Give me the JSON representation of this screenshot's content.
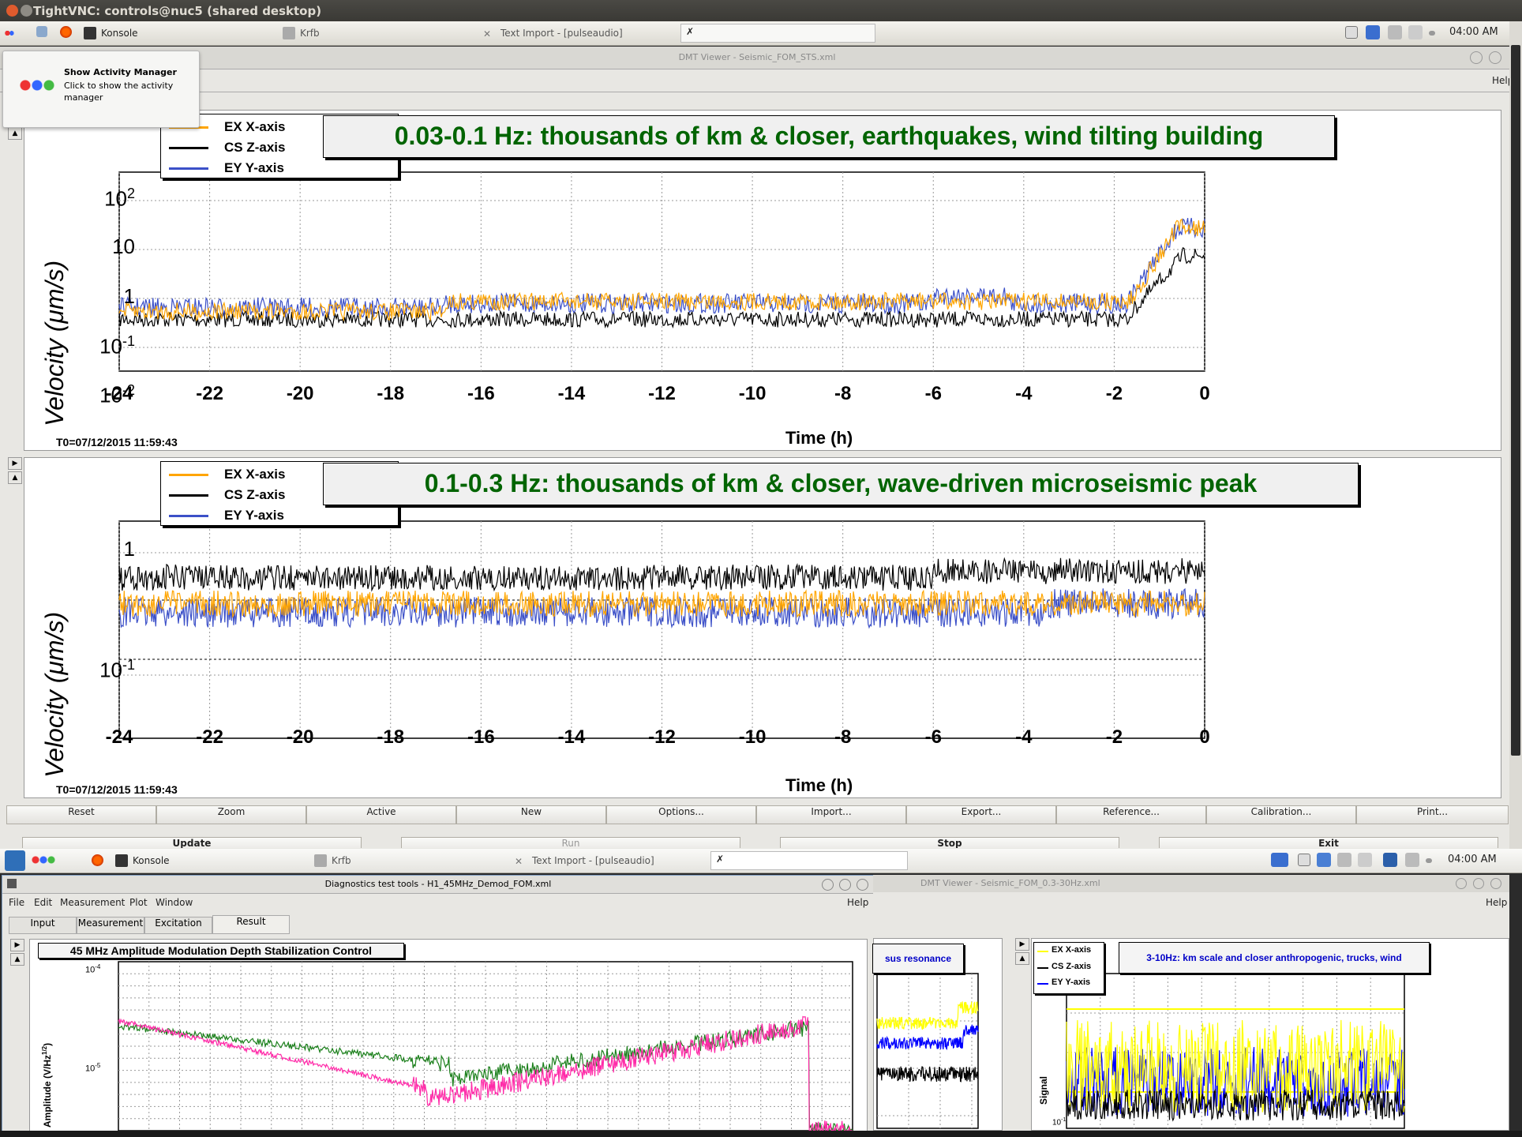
{
  "window": {
    "title": "TightVNC: controls@nuc5 (shared desktop)"
  },
  "taskbar_top": {
    "items": [
      "Konsole",
      "Krfb",
      "Text Import - [pulseaudio]"
    ],
    "clock": "04:00 AM",
    "tray_num": "2|1"
  },
  "tooltip": {
    "title": "Show Activity Manager",
    "body": "Click to show the activity manager"
  },
  "dmt": {
    "title": "DMT Viewer - Seismic_FOM_STS.xml",
    "help": "Help",
    "plots": [
      {
        "title": "0.03-0.1 Hz: thousands of km & closer, earthquakes, wind tilting building",
        "ylabel": "Velocity  (μm/s)",
        "xlabel": "Time (h)",
        "t0": "T0=07/12/2015 11:59:43",
        "yticks": [
          "10",
          "1",
          "10",
          "10"
        ],
        "ytick_exps": [
          "2",
          "",
          "-1",
          "-2"
        ],
        "xticks": [
          "-24",
          "-22",
          "-20",
          "-18",
          "-16",
          "-14",
          "-12",
          "-10",
          "-8",
          "-6",
          "-4",
          "-2",
          "0"
        ]
      },
      {
        "title": "0.1-0.3 Hz: thousands of km & closer, wave-driven microseismic peak",
        "ylabel": "Velocity  (μm/s)",
        "xlabel": "Time (h)",
        "t0": "T0=07/12/2015 11:59:43",
        "yticks": [
          "1",
          "10"
        ],
        "ytick_exps": [
          "",
          "-1"
        ],
        "xticks": [
          "-24",
          "-22",
          "-20",
          "-18",
          "-16",
          "-14",
          "-12",
          "-10",
          "-8",
          "-6",
          "-4",
          "-2",
          "0"
        ]
      }
    ],
    "legend": [
      {
        "name": "EX X-axis",
        "color": "#ffa500"
      },
      {
        "name": "CS Z-axis",
        "color": "#000000"
      },
      {
        "name": "EY Y-axis",
        "color": "#3c50c8"
      }
    ],
    "toolbar": [
      "Reset",
      "Zoom",
      "Active",
      "New",
      "Options...",
      "Import...",
      "Export...",
      "Reference...",
      "Calibration...",
      "Print..."
    ],
    "toolbar2": [
      "Update",
      "Run",
      "Stop",
      "Exit"
    ]
  },
  "taskbar_bottom": {
    "items": [
      "Konsole",
      "Krfb",
      "Text Import - [pulseaudio]"
    ],
    "clock": "04:00 AM"
  },
  "diag": {
    "title": "Diagnostics test tools - H1_45MHz_Demod_FOM.xml",
    "menu": [
      "File",
      "Edit",
      "Measurement",
      "Plot",
      "Window"
    ],
    "help": "Help",
    "tabs": [
      "Input",
      "Measurement",
      "Excitation",
      "Result"
    ],
    "plot_title": "45 MHz Amplitude Modulation Depth Stabilization Control",
    "ylabel": "Amplitude (V/Hz",
    "ylabel_sup": "1/2",
    "ylabel_end": ")",
    "ytick_top": "10",
    "ytick_top_exp": "-4",
    "ytick_mid": "10",
    "ytick_mid_exp": "-5"
  },
  "dmt2": {
    "title": "DMT Viewer - Seismic_FOM_0.3-30Hz.xml",
    "help": "Help",
    "left_title": "sus resonance",
    "right_title": "3-10Hz: km scale and closer anthropogenic, trucks, wind",
    "ylabel": "Signal",
    "ytick": "10",
    "ytick_exp": "-1",
    "legend": [
      {
        "name": "EX X-axis",
        "color": "#ffff00"
      },
      {
        "name": "CS Z-axis",
        "color": "#000000"
      },
      {
        "name": "EY Y-axis",
        "color": "#0000ff"
      }
    ]
  }
}
